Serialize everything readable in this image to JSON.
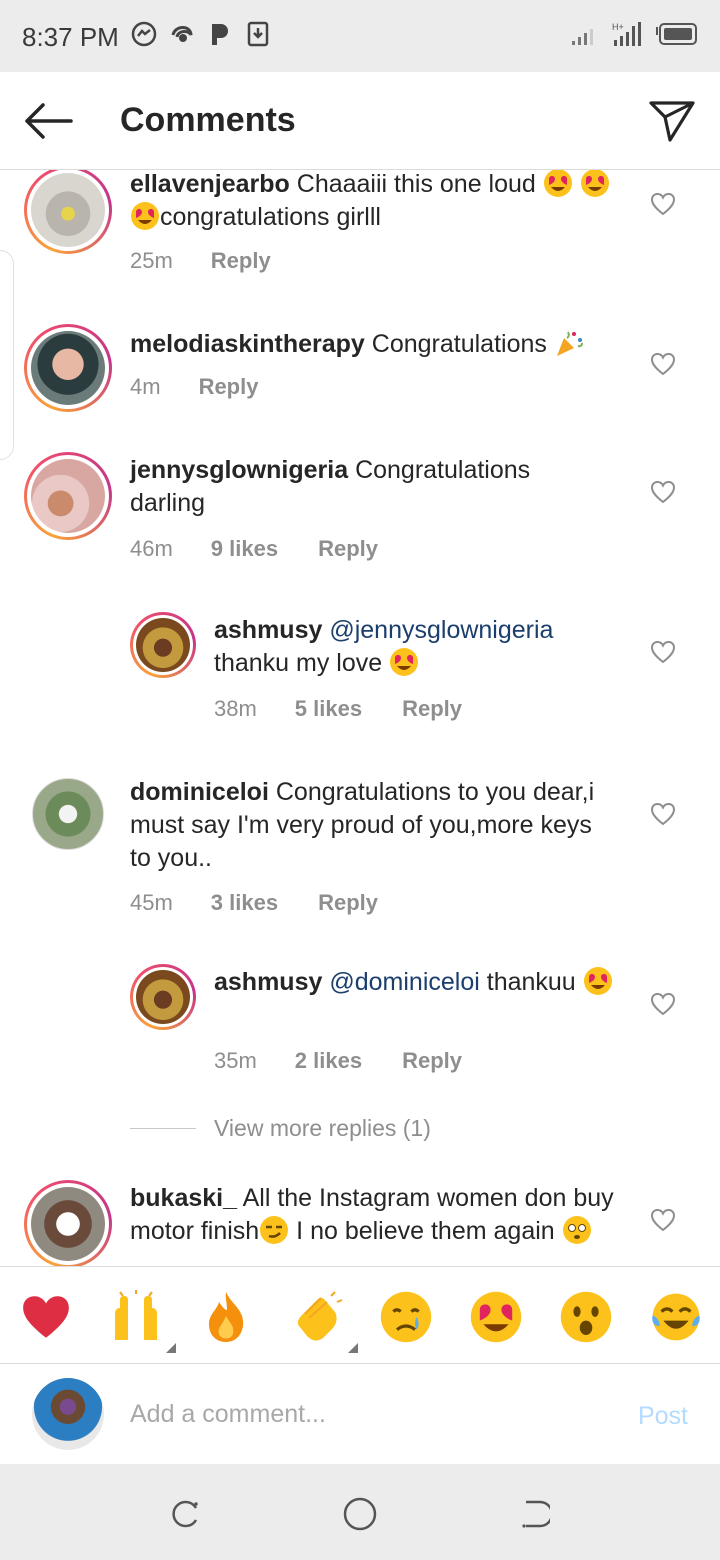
{
  "status_bar": {
    "time": "8:37 PM",
    "icons": [
      "messenger-icon",
      "swirl-app-icon",
      "p-app-icon",
      "download-icon"
    ],
    "right_icons": [
      "signal-icon",
      "data-signal-icon",
      "battery-icon"
    ]
  },
  "header": {
    "title": "Comments",
    "back_icon": "arrow-left-icon",
    "send_icon": "paper-plane-icon"
  },
  "comments": [
    {
      "username": "ellavenjearbo",
      "text_before": "Chaaaiii this one loud",
      "text_after": "congratulations girlll",
      "emojis": [
        "heart-eyes",
        "heart-eyes",
        "heart-eyes"
      ],
      "time": "25m",
      "likes": "",
      "reply_label": "Reply"
    },
    {
      "username": "melodiaskintherapy",
      "text": "Congratulations",
      "emojis": [
        "party-popper"
      ],
      "time": "4m",
      "likes": "",
      "reply_label": "Reply"
    },
    {
      "username": "jennysglownigeria",
      "text": "Congratulations darling",
      "time": "46m",
      "likes": "9 likes",
      "reply_label": "Reply"
    },
    {
      "username": "ashmusy",
      "mention": "@jennysglownigeria",
      "text": "thanku my love",
      "emojis": [
        "heart-eyes"
      ],
      "time": "38m",
      "likes": "5 likes",
      "reply_label": "Reply"
    },
    {
      "username": "dominiceloi",
      "text": "Congratulations to you dear,i must say I'm very proud of you,more keys to you..",
      "time": "45m",
      "likes": "3 likes",
      "reply_label": "Reply"
    },
    {
      "username": "ashmusy",
      "mention": "@dominiceloi",
      "text": "thankuu",
      "emojis": [
        "heart-eyes"
      ],
      "time": "35m",
      "likes": "2 likes",
      "reply_label": "Reply"
    },
    {
      "username": "bukaski_",
      "text_before": "All the Instagram women don buy motor finish",
      "text_after": "I no believe them",
      "text_cut": "again",
      "emojis": [
        "smirk",
        "flushed"
      ]
    }
  ],
  "view_more_replies": "View more replies (1)",
  "reactions": [
    "red-heart",
    "raising-hands",
    "fire",
    "clapping-hands",
    "crying-face",
    "heart-eyes",
    "surprised-face",
    "tears-of-joy"
  ],
  "composer": {
    "placeholder": "Add a comment...",
    "post_label": "Post"
  },
  "nav": [
    "recent-apps-icon",
    "home-icon",
    "back-icon"
  ],
  "colors": {
    "mention": "#1b3e6d",
    "post_disabled": "#b3dbff",
    "meta_gray": "#8e8e8e",
    "story_ring": "#c2358a"
  }
}
